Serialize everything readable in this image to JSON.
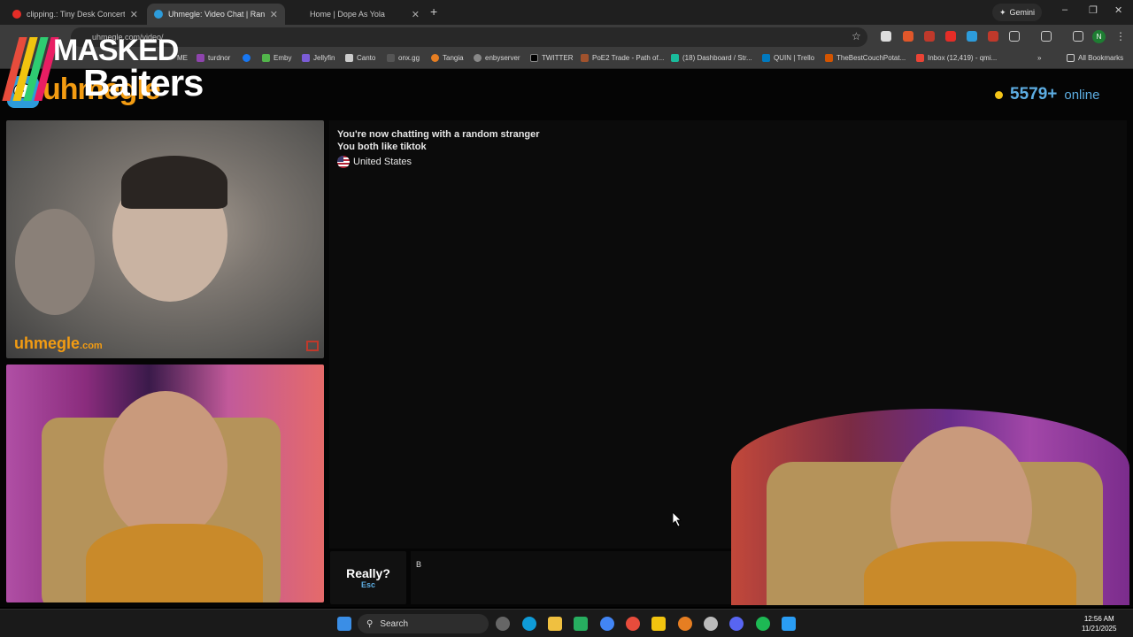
{
  "browser": {
    "tabs": [
      {
        "title": "clipping.: Tiny Desk Concert - Yo",
        "icon": "youtube-icon",
        "active": false
      },
      {
        "title": "Uhmegle: Video Chat | Rand",
        "icon": "uhmegle-icon",
        "active": true
      },
      {
        "title": "Home | Dope As Yola",
        "icon": "page-icon",
        "active": false
      }
    ],
    "gemini_label": "Gemini",
    "url": "uhmegle.com/video/",
    "bookmarks": [
      "ME",
      "turdnor",
      "Emby",
      "Jellyfin",
      "Canto",
      "onx.gg",
      "Tangia",
      "enbyserver",
      "TWITTER",
      "PoE2 Trade - Path of...",
      "(18) Dashboard / Str...",
      "QUIN | Trello",
      "TheBestCouchPotat...",
      "Inbox (12,419) - qmi..."
    ],
    "all_bookmarks": "All Bookmarks",
    "profile_initial": "N"
  },
  "overlay": {
    "line1": "MASKED",
    "line2": "Baiters"
  },
  "site": {
    "logo_text": "uhmegle",
    "online_count": "5579+",
    "online_label": "online"
  },
  "stranger_video": {
    "watermark": "uhmegle",
    "watermark_suffix": ".com"
  },
  "chat": {
    "line1": "You're now chatting with a random stranger",
    "line2": "You both like tiktok",
    "country": "United States"
  },
  "controls": {
    "stop_label": "Really?",
    "stop_hint": "Esc",
    "message_value": "B"
  },
  "taskbar": {
    "search_label": "Search",
    "time": "12:56 AM",
    "date": "11/21/2025"
  },
  "colors": {
    "brand_orange": "#f39c12",
    "accent_blue": "#5dade2",
    "status_dot": "#f5c518"
  }
}
